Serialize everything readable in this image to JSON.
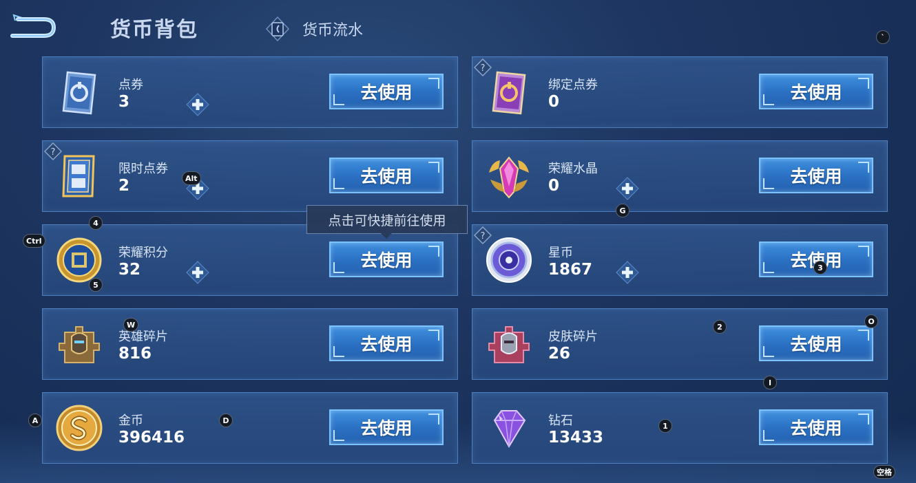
{
  "header": {
    "title": "货币背包",
    "history_label": "货币流水"
  },
  "use_label": "去使用",
  "tooltip": "点击可快捷前往使用",
  "currencies": [
    {
      "name": "点券",
      "count": "3",
      "icon": "coupon-card-icon",
      "has_plus": true,
      "has_help": false
    },
    {
      "name": "绑定点券",
      "count": "0",
      "icon": "bound-coupon-card-icon",
      "has_plus": false,
      "has_help": true
    },
    {
      "name": "限时点券",
      "count": "2",
      "icon": "limited-coupon-icon",
      "has_plus": true,
      "has_help": true
    },
    {
      "name": "荣耀水晶",
      "count": "0",
      "icon": "glory-crystal-icon",
      "has_plus": true,
      "has_help": false
    },
    {
      "name": "荣耀积分",
      "count": "32",
      "icon": "glory-points-icon",
      "has_plus": true,
      "has_help": false
    },
    {
      "name": "星币",
      "count": "1867",
      "icon": "star-coin-icon",
      "has_plus": true,
      "has_help": true
    },
    {
      "name": "英雄碎片",
      "count": "816",
      "icon": "hero-fragment-icon",
      "has_plus": false,
      "has_help": false
    },
    {
      "name": "皮肤碎片",
      "count": "26",
      "icon": "skin-fragment-icon",
      "has_plus": false,
      "has_help": false
    },
    {
      "name": "金币",
      "count": "396416",
      "icon": "gold-coin-icon",
      "has_plus": false,
      "has_help": false
    },
    {
      "name": "钻石",
      "count": "13433",
      "icon": "diamond-icon",
      "has_plus": false,
      "has_help": false
    }
  ],
  "key_hints": [
    "`",
    "Alt",
    "4",
    "G",
    "Ctrl",
    "5",
    "3",
    "W",
    "2",
    "O",
    "I",
    "A",
    "D",
    "1",
    "空格"
  ],
  "colors": {
    "background": "#1d3560",
    "card": "#2f5690",
    "card_border": "#4d7fc0",
    "button": "#2a6fc2",
    "button_border": "#7cc2ff"
  }
}
